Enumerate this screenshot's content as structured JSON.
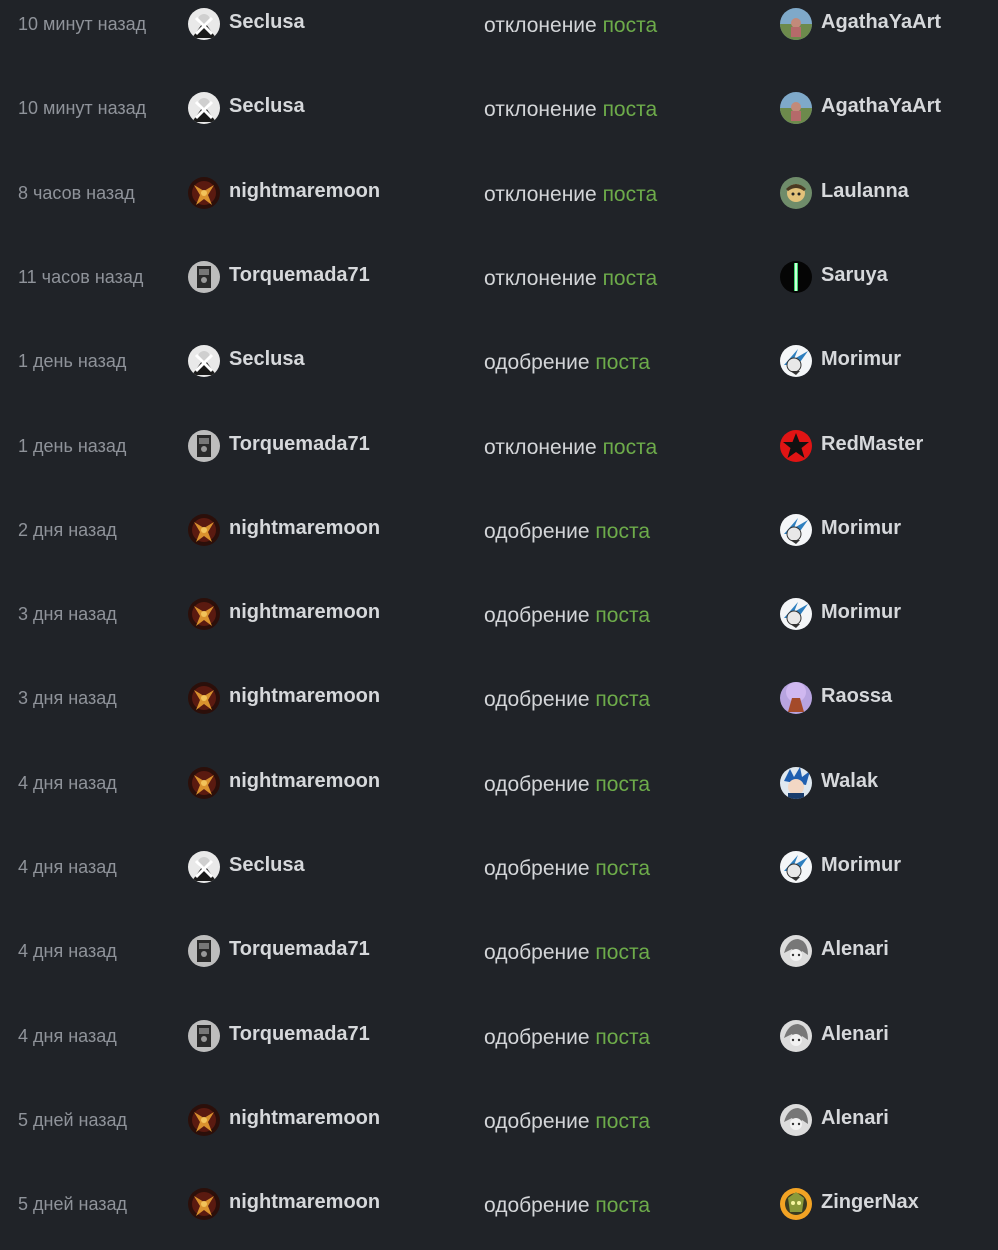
{
  "rows": [
    {
      "time": "10 минут назад",
      "moderator": {
        "name": "Seclusa",
        "avatar": "seclusa"
      },
      "action": "отклонение",
      "target": "поста",
      "author": {
        "name": "AgathaYaArt",
        "avatar": "agatha"
      }
    },
    {
      "time": "10 минут назад",
      "moderator": {
        "name": "Seclusa",
        "avatar": "seclusa"
      },
      "action": "отклонение",
      "target": "поста",
      "author": {
        "name": "AgathaYaArt",
        "avatar": "agatha"
      }
    },
    {
      "time": "8 часов назад",
      "moderator": {
        "name": "nightmaremoon",
        "avatar": "nightmaremoon"
      },
      "action": "отклонение",
      "target": "поста",
      "author": {
        "name": "Laulanna",
        "avatar": "laulanna"
      }
    },
    {
      "time": "11 часов назад",
      "moderator": {
        "name": "Torquemada71",
        "avatar": "torquemada"
      },
      "action": "отклонение",
      "target": "поста",
      "author": {
        "name": "Saruya",
        "avatar": "saruya"
      }
    },
    {
      "time": "1 день назад",
      "moderator": {
        "name": "Seclusa",
        "avatar": "seclusa"
      },
      "action": "одобрение",
      "target": "поста",
      "author": {
        "name": "Morimur",
        "avatar": "morimur"
      }
    },
    {
      "time": "1 день назад",
      "moderator": {
        "name": "Torquemada71",
        "avatar": "torquemada"
      },
      "action": "отклонение",
      "target": "поста",
      "author": {
        "name": "RedMaster",
        "avatar": "redmaster"
      }
    },
    {
      "time": "2 дня назад",
      "moderator": {
        "name": "nightmaremoon",
        "avatar": "nightmaremoon"
      },
      "action": "одобрение",
      "target": "поста",
      "author": {
        "name": "Morimur",
        "avatar": "morimur"
      }
    },
    {
      "time": "3 дня назад",
      "moderator": {
        "name": "nightmaremoon",
        "avatar": "nightmaremoon"
      },
      "action": "одобрение",
      "target": "поста",
      "author": {
        "name": "Morimur",
        "avatar": "morimur"
      }
    },
    {
      "time": "3 дня назад",
      "moderator": {
        "name": "nightmaremoon",
        "avatar": "nightmaremoon"
      },
      "action": "одобрение",
      "target": "поста",
      "author": {
        "name": "Raossa",
        "avatar": "raossa"
      }
    },
    {
      "time": "4 дня назад",
      "moderator": {
        "name": "nightmaremoon",
        "avatar": "nightmaremoon"
      },
      "action": "одобрение",
      "target": "поста",
      "author": {
        "name": "Walak",
        "avatar": "walak"
      }
    },
    {
      "time": "4 дня назад",
      "moderator": {
        "name": "Seclusa",
        "avatar": "seclusa"
      },
      "action": "одобрение",
      "target": "поста",
      "author": {
        "name": "Morimur",
        "avatar": "morimur"
      }
    },
    {
      "time": "4 дня назад",
      "moderator": {
        "name": "Torquemada71",
        "avatar": "torquemada"
      },
      "action": "одобрение",
      "target": "поста",
      "author": {
        "name": "Alenari",
        "avatar": "alenari"
      }
    },
    {
      "time": "4 дня назад",
      "moderator": {
        "name": "Torquemada71",
        "avatar": "torquemada"
      },
      "action": "одобрение",
      "target": "поста",
      "author": {
        "name": "Alenari",
        "avatar": "alenari"
      }
    },
    {
      "time": "5 дней назад",
      "moderator": {
        "name": "nightmaremoon",
        "avatar": "nightmaremoon"
      },
      "action": "одобрение",
      "target": "поста",
      "author": {
        "name": "Alenari",
        "avatar": "alenari"
      }
    },
    {
      "time": "5 дней назад",
      "moderator": {
        "name": "nightmaremoon",
        "avatar": "nightmaremoon"
      },
      "action": "одобрение",
      "target": "поста",
      "author": {
        "name": "ZingerNax",
        "avatar": "zingernax"
      }
    }
  ],
  "colors": {
    "background": "#202328",
    "time_text": "#8f939a",
    "username_text": "#d6d8db",
    "action_text": "#d3d5d8",
    "post_link": "#6dab4a"
  }
}
